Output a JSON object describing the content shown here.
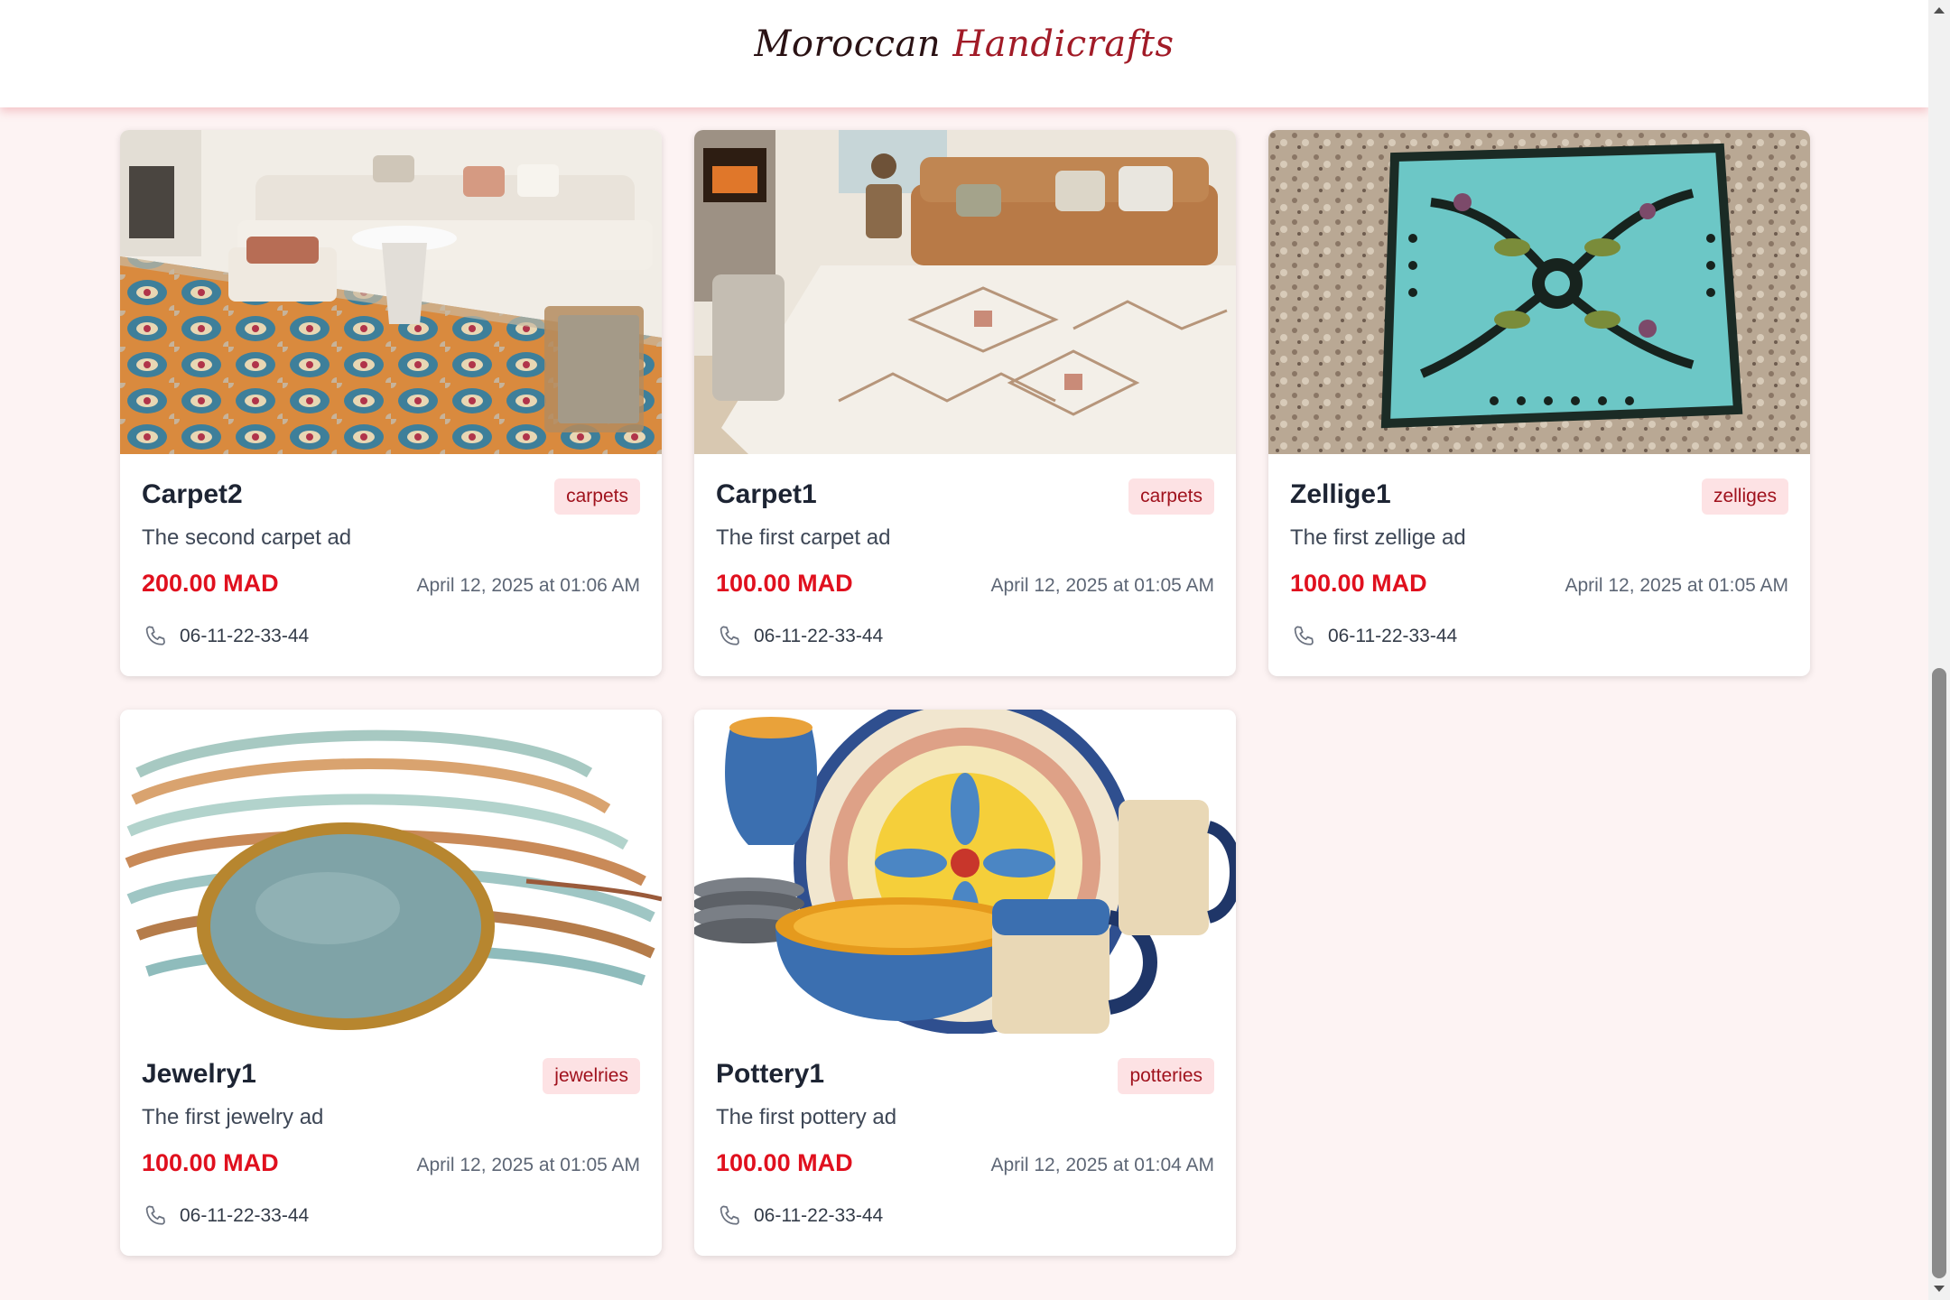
{
  "header": {
    "logo_main": "Moroccan ",
    "logo_accent": "Handicrafts"
  },
  "colors": {
    "page_background": "#fdf3f3",
    "price": "#e0101e",
    "badge_background": "#fde2e4",
    "badge_text": "#a0121d",
    "logo_accent": "#a11b27"
  },
  "cards": [
    {
      "title": "Carpet2",
      "category": "carpets",
      "description": "The second carpet ad",
      "price": "200.00 MAD",
      "date": "April 12, 2025 at 01:06 AM",
      "phone": "06-11-22-33-44",
      "image": "living-room-colorful-rug-photo"
    },
    {
      "title": "Carpet1",
      "category": "carpets",
      "description": "The first carpet ad",
      "price": "100.00 MAD",
      "date": "April 12, 2025 at 01:05 AM",
      "phone": "06-11-22-33-44",
      "image": "living-room-berber-rug-photo"
    },
    {
      "title": "Zellige1",
      "category": "zelliges",
      "description": "The first zellige ad",
      "price": "100.00 MAD",
      "date": "April 12, 2025 at 01:05 AM",
      "phone": "06-11-22-33-44",
      "image": "turquoise-zellige-tile-photo"
    },
    {
      "title": "Jewelry1",
      "category": "jewelries",
      "description": "The first jewelry ad",
      "price": "100.00 MAD",
      "date": "April 12, 2025 at 01:05 AM",
      "phone": "06-11-22-33-44",
      "image": "beaded-wrap-bracelet-photo"
    },
    {
      "title": "Pottery1",
      "category": "potteries",
      "description": "The first pottery ad",
      "price": "100.00 MAD",
      "date": "April 12, 2025 at 01:04 AM",
      "phone": "06-11-22-33-44",
      "image": "painted-pottery-dinnerware-photo"
    }
  ]
}
